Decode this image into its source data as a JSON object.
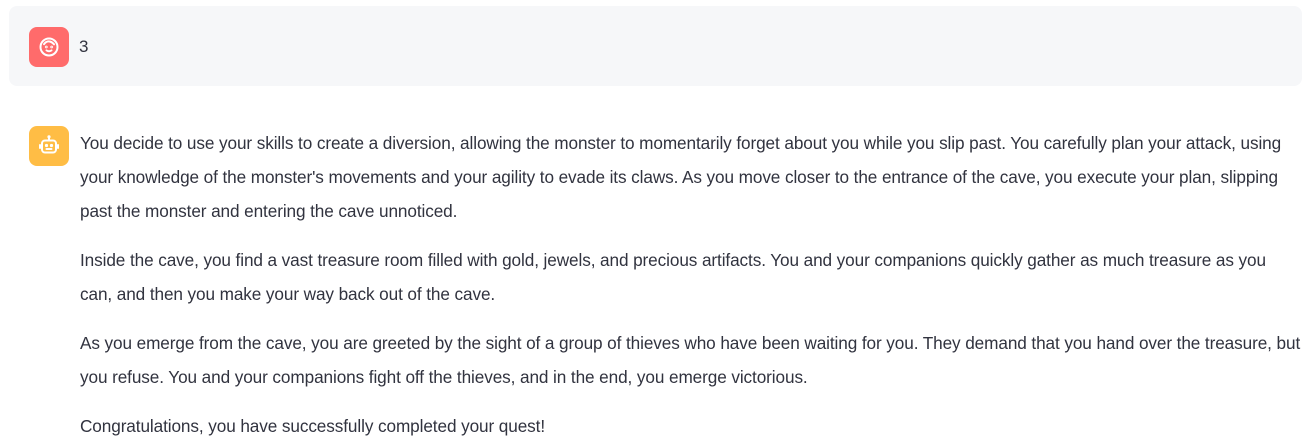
{
  "messages": [
    {
      "role": "user",
      "avatar_icon": "face-icon",
      "avatar_color": "#ff6b6b",
      "text": "3"
    },
    {
      "role": "assistant",
      "avatar_icon": "robot-icon",
      "avatar_color": "#ffbd45",
      "paragraphs": [
        "You decide to use your skills to create a diversion, allowing the monster to momentarily forget about you while you slip past. You carefully plan your attack, using your knowledge of the monster's movements and your agility to evade its claws. As you move closer to the entrance of the cave, you execute your plan, slipping past the monster and entering the cave unnoticed.",
        "Inside the cave, you find a vast treasure room filled with gold, jewels, and precious artifacts. You and your companions quickly gather as much treasure as you can, and then you make your way back out of the cave.",
        "As you emerge from the cave, you are greeted by the sight of a group of thieves who have been waiting for you. They demand that you hand over the treasure, but you refuse. You and your companions fight off the thieves, and in the end, you emerge victorious.",
        "Congratulations, you have successfully completed your quest!"
      ]
    }
  ]
}
